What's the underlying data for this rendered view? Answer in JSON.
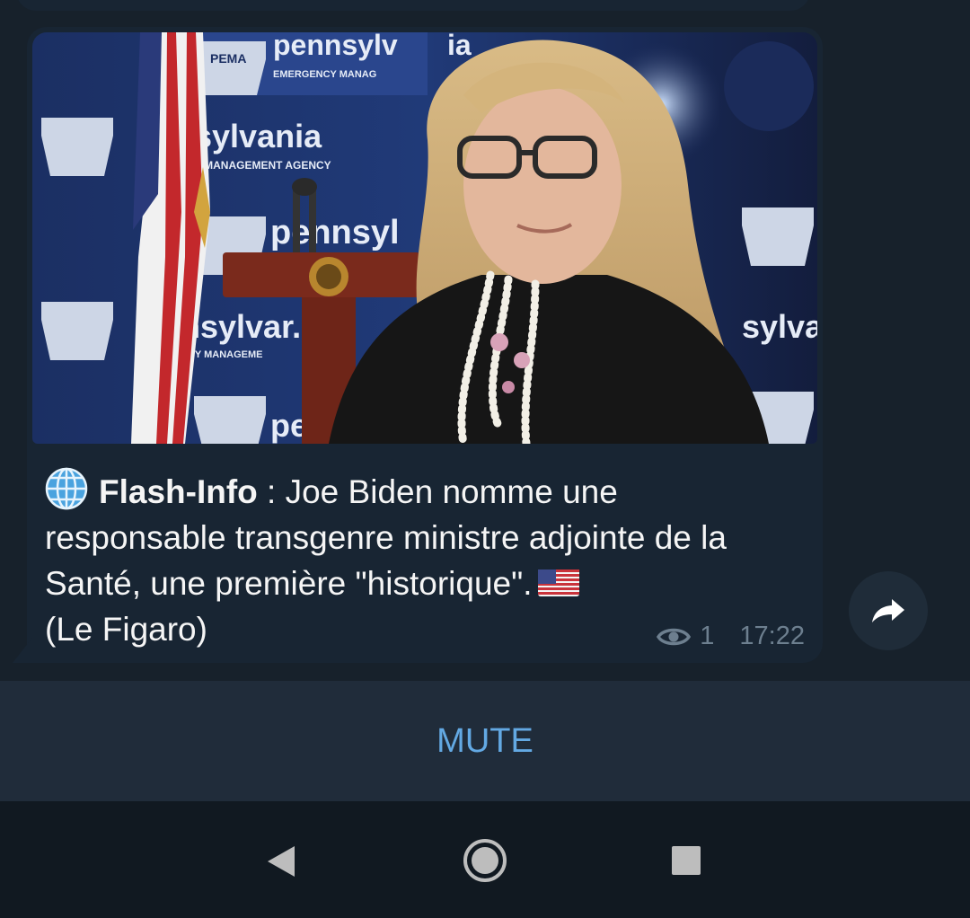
{
  "message": {
    "image_alt": "Photo of a woman with long wavy blonde hair and glasses in front of a Pennsylvania Emergency Management Agency backdrop",
    "backdrop_texts": [
      "pennsylv",
      "EMERGENCY MANAG",
      "ia",
      "sylvania",
      "Y MANAGEMENT AGENCY",
      "pennsyl",
      "nsylvar.",
      "NCY MANAGEME",
      "sylva",
      "pe",
      "PEMA"
    ],
    "caption_icon": "globe-icon",
    "caption_bold": "Flash-Info",
    "caption_text": " : Joe Biden nomme une responsable transgenre ministre adjointe de la Santé, une première \"historique\".",
    "caption_flag": "us-flag-icon",
    "caption_source": "(Le Figaro)",
    "views": "1",
    "time": "17:22"
  },
  "actions": {
    "share_icon": "share-arrow-icon",
    "mute_label": "MUTE"
  },
  "navbar": {
    "back_icon": "back-triangle-icon",
    "home_icon": "home-circle-icon",
    "recent_icon": "recent-square-icon"
  },
  "colors": {
    "background": "#17212b",
    "bubble": "#182533",
    "accent": "#63a9e3",
    "meta": "#6d7f8f"
  }
}
